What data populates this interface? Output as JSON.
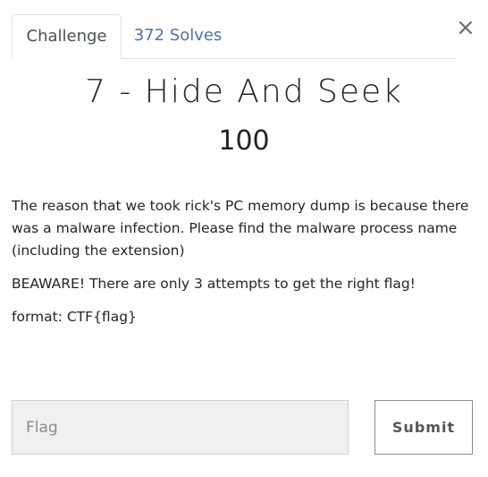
{
  "dialog": {
    "close_symbol": "×"
  },
  "tabs": [
    {
      "label": "Challenge",
      "active": true
    },
    {
      "label": "372 Solves",
      "active": false
    }
  ],
  "challenge": {
    "title": "7 - Hide And Seek",
    "points": "100",
    "description": [
      "The reason that we took rick's PC memory dump is because there was a malware infection. Please find the malware process name (including the extension)",
      "BEAWARE! There are only 3 attempts to get the right flag!",
      "format: CTF{flag}"
    ]
  },
  "form": {
    "flag_placeholder": "Flag",
    "flag_value": "",
    "submit_label": "Submit"
  },
  "colors": {
    "tab_link": "#4a72b2",
    "input_bg": "#f0f0f0"
  },
  "icons": {
    "close": "close-icon"
  }
}
